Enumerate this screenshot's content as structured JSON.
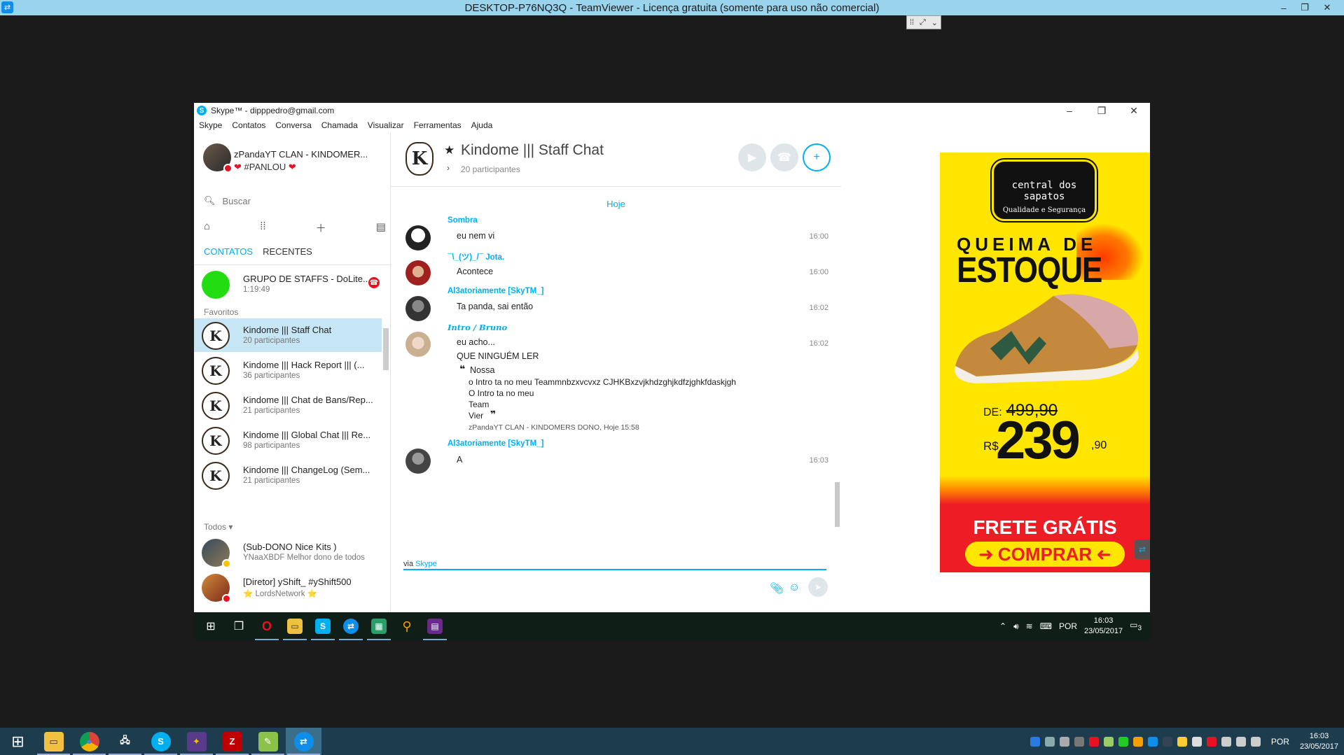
{
  "teamviewer": {
    "title": "DESKTOP-P76NQ3Q - TeamViewer - Licença gratuita (somente para uso não comercial)",
    "minimize": "–",
    "restore": "❐",
    "close": "✕"
  },
  "skype": {
    "window_title": "Skype™ - dipppedro@gmail.com",
    "menu": [
      "Skype",
      "Contatos",
      "Conversa",
      "Chamada",
      "Visualizar",
      "Ferramentas",
      "Ajuda"
    ],
    "profile": {
      "name": "zPandaYT CLAN - KINDOMER...",
      "mood": "#PANLOU",
      "heart": "❤"
    },
    "search_placeholder": "Buscar",
    "tabs": {
      "contacts": "CONTATOS",
      "recent": "RECENTES"
    },
    "active_call": {
      "name": "GRUPO DE STAFFS - DoLite...",
      "duration": "1:19:49"
    },
    "favorites_label": "Favoritos",
    "favorites": [
      {
        "name": "Kindome ||| Staff Chat",
        "sub": "20 participantes"
      },
      {
        "name": "Kindome ||| Hack Report ||| (...",
        "sub": "36 participantes"
      },
      {
        "name": "Kindome ||| Chat de Bans/Rep...",
        "sub": "21 participantes"
      },
      {
        "name": "Kindome ||| Global Chat ||| Re...",
        "sub": "98 participantes"
      },
      {
        "name": "Kindome ||| ChangeLog (Sem...",
        "sub": "21 participantes"
      }
    ],
    "all_label": "Todos ▾",
    "contacts": [
      {
        "name": "(Sub-DONO Nice Kits )",
        "sub": "YNaaXBDF Melhor dono de todos"
      },
      {
        "name": "[Diretor] yShift_ #yShift500",
        "sub": "LordsNetwork",
        "star": "⭐"
      }
    ],
    "chat": {
      "title": "Kindome ||| Staff Chat",
      "participants": "20 participantes",
      "today": "Hoje",
      "messages": [
        {
          "author": "Sombra",
          "text": "eu nem vi",
          "time": "16:00"
        },
        {
          "author": "¯\\_(ツ)_/¯ Jota.",
          "text": "Acontece",
          "time": "16:00"
        },
        {
          "author": "Al3atoriamente [SkyTM_]",
          "text": "Ta panda, sai então",
          "time": "16:02"
        },
        {
          "author": "Intro / Bruno",
          "text": "eu acho...",
          "text2": "QUE NINGUÉM LER",
          "time": "16:02"
        },
        {
          "author": "Al3atoriamente [SkyTM_]",
          "text": "A",
          "time": "16:03"
        }
      ],
      "quote": {
        "first": "Nossa",
        "lines": [
          "o Intro ta no meu Teammnbzxvcvxz CJHKBxzvjkhdzghjkdfzjghkfdaskjgh",
          "O Intro ta no meu",
          "Team",
          "Vier"
        ],
        "meta": "zPandaYT CLAN - KINDOMERS DONO, Hoje 15:58"
      },
      "via_prefix": "via",
      "via_link": "Skype"
    }
  },
  "ad": {
    "brand": "central dos sapatos",
    "tagline": "Qualidade e Segurança",
    "headline1": "QUEIMA DE",
    "headline2": "ESTOQUE",
    "de_label": "DE:",
    "old_price": "499,90",
    "currency": "R$",
    "price_int": "239",
    "price_cents": ",90",
    "frete": "FRETE GRÁTIS",
    "cta": "COMPRAR"
  },
  "inner_taskbar": {
    "lang": "POR",
    "time": "16:03",
    "date": "23/05/2017",
    "notif": "3"
  },
  "host_taskbar": {
    "lang": "POR",
    "time": "16:03",
    "date": "23/05/2017"
  },
  "colors": {
    "skype_blue": "#00aff0",
    "selected_row": "#c7e6f5",
    "ad_yellow": "#ffe600",
    "ad_red": "#ee1c25"
  }
}
